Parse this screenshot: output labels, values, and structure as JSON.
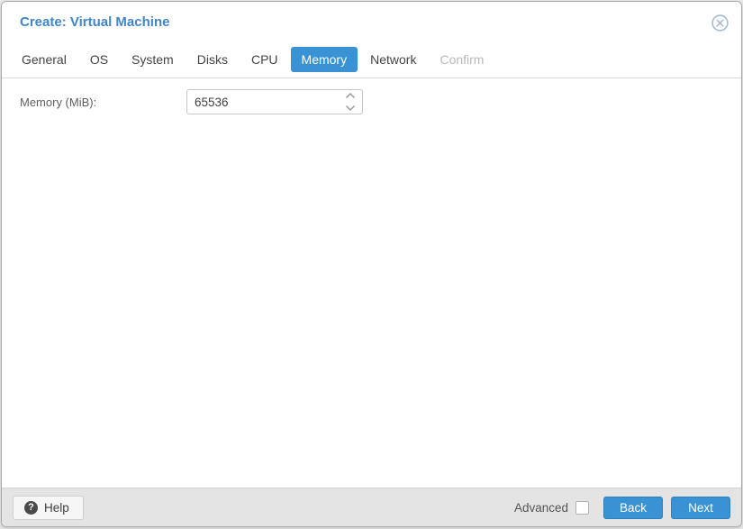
{
  "window": {
    "title": "Create: Virtual Machine",
    "close_icon": "circle-x-icon"
  },
  "tabs": [
    {
      "label": "General",
      "state": "normal"
    },
    {
      "label": "OS",
      "state": "normal"
    },
    {
      "label": "System",
      "state": "normal"
    },
    {
      "label": "Disks",
      "state": "normal"
    },
    {
      "label": "CPU",
      "state": "normal"
    },
    {
      "label": "Memory",
      "state": "active"
    },
    {
      "label": "Network",
      "state": "normal"
    },
    {
      "label": "Confirm",
      "state": "disabled"
    }
  ],
  "form": {
    "memory_label": "Memory (MiB):",
    "memory_value": "65536",
    "spinner_icons": [
      "chevron-up-icon",
      "chevron-down-icon"
    ]
  },
  "footer": {
    "help_label": "Help",
    "help_icon": "question-circle-icon",
    "advanced_label": "Advanced",
    "advanced_checked": false,
    "back_label": "Back",
    "next_label": "Next"
  },
  "colors": {
    "accent_blue": "#3892d4",
    "title_blue": "#4186c7",
    "tab_text": "#444444",
    "tab_disabled": "#b8b8b8",
    "footer_bg": "#e4e4e4",
    "close_icon": "#a3bcd2"
  }
}
